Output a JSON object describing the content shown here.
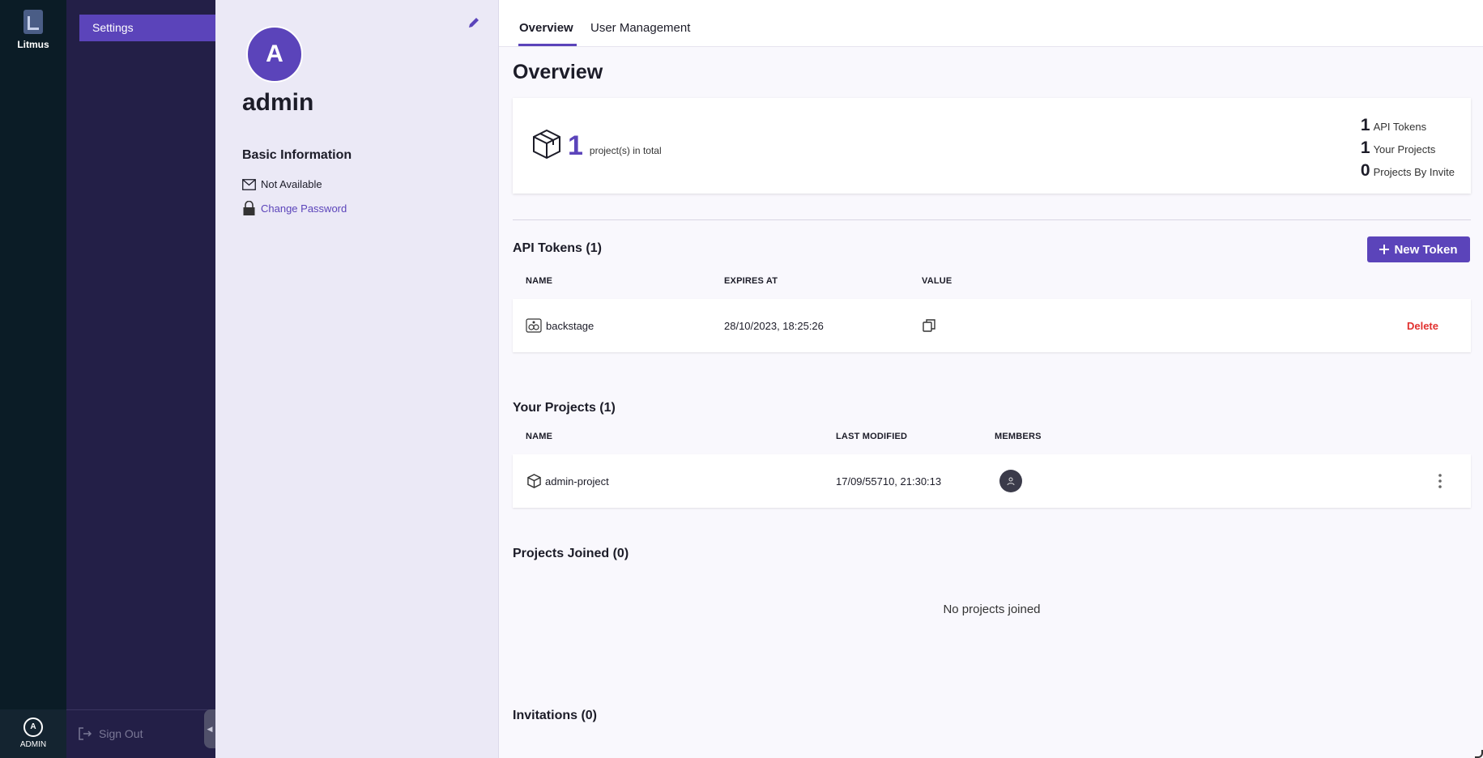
{
  "app": {
    "logo_text": "Litmus",
    "user_initial": "A",
    "user_label": "ADMIN"
  },
  "sidebar": {
    "items": [
      {
        "label": "Settings"
      }
    ],
    "sign_out": "Sign Out"
  },
  "profile": {
    "initial": "A",
    "username": "admin",
    "basic_info_heading": "Basic Information",
    "email": "Not Available",
    "change_password": "Change Password"
  },
  "tabs": [
    {
      "label": "Overview"
    },
    {
      "label": "User Management"
    }
  ],
  "overview": {
    "heading": "Overview",
    "projects_total": "1",
    "projects_total_suffix": "project(s) in total",
    "stats": [
      {
        "value": "1",
        "label": "API Tokens"
      },
      {
        "value": "1",
        "label": "Your Projects"
      },
      {
        "value": "0",
        "label": "Projects By Invite"
      }
    ]
  },
  "api_tokens": {
    "heading": "API Tokens (1)",
    "new_token_label": "New Token",
    "columns": [
      "NAME",
      "EXPIRES AT",
      "VALUE"
    ],
    "rows": [
      {
        "name": "backstage",
        "expires_at": "28/10/2023, 18:25:26",
        "delete_label": "Delete"
      }
    ]
  },
  "your_projects": {
    "heading": "Your Projects (1)",
    "columns": [
      "NAME",
      "LAST MODIFIED",
      "MEMBERS"
    ],
    "rows": [
      {
        "name": "admin-project",
        "last_modified": "17/09/55710, 21:30:13"
      }
    ]
  },
  "projects_joined": {
    "heading": "Projects Joined (0)",
    "empty_text": "No projects joined"
  },
  "invitations": {
    "heading": "Invitations (0)"
  },
  "colors": {
    "accent": "#5b44ba",
    "rail": "#0b1c26",
    "sidebar": "#231f47",
    "danger": "#e1312f"
  },
  "icons": [
    "edit-icon",
    "mail-icon",
    "lock-icon",
    "cube-icon",
    "copy-icon",
    "kebab-icon",
    "plus-icon",
    "sign-out-icon",
    "user-icon",
    "collapse-icon"
  ]
}
